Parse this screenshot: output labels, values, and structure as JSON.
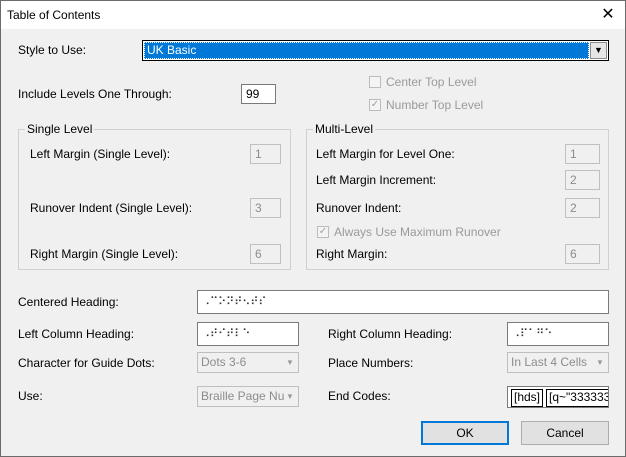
{
  "window": {
    "title": "Table of Contents",
    "close_glyph": "✕"
  },
  "style": {
    "label": "Style to Use:",
    "value": "UK Basic"
  },
  "levels": {
    "label": "Include Levels One Through:",
    "value": "99"
  },
  "center_top_level": {
    "label": "Center Top Level",
    "checked": false
  },
  "number_top_level": {
    "label": "Number Top Level",
    "checked": true,
    "mark": "✓"
  },
  "single_level": {
    "title": "Single Level",
    "left_margin_label": "Left Margin (Single Level):",
    "left_margin_value": "1",
    "runover_label": "Runover Indent (Single Level):",
    "runover_value": "3",
    "right_margin_label": "Right Margin (Single Level):",
    "right_margin_value": "6"
  },
  "multi_level": {
    "title": "Multi-Level",
    "left_margin_label": "Left Margin for Level One:",
    "left_margin_value": "1",
    "increment_label": "Left Margin Increment:",
    "increment_value": "2",
    "runover_label": "Runover Indent:",
    "runover_value": "2",
    "always_max_label": "Always Use Maximum Runover",
    "always_max_mark": "✓",
    "right_margin_label": "Right Margin:",
    "right_margin_value": "6"
  },
  "centered_heading": {
    "label": "Centered Heading:",
    "value": "⠠⠉⠕⠝⠞⠢⠞⠎"
  },
  "left_column": {
    "label": "Left Column Heading:",
    "value": "⠠⠞⠊⠞⠇⠑"
  },
  "right_column": {
    "label": "Right Column Heading:",
    "value": "⠠⠏⠁⠛⠑"
  },
  "guide_dots": {
    "label": "Character for Guide Dots:",
    "value": "Dots 3-6"
  },
  "place_numbers": {
    "label": "Place Numbers:",
    "value": "In Last 4 Cells"
  },
  "use": {
    "label": "Use:",
    "value": "Braille Page Nu"
  },
  "end_codes": {
    "label": "End Codes:",
    "code1": "[hds]",
    "code2": "[q~\"333333"
  },
  "buttons": {
    "ok": "OK",
    "cancel": "Cancel"
  },
  "icons": {
    "dropdown": "▼"
  },
  "colors": {
    "selection": "#0078d7",
    "default_button_border": "#0078d7",
    "dialog_bg": "#f0f0f0"
  }
}
